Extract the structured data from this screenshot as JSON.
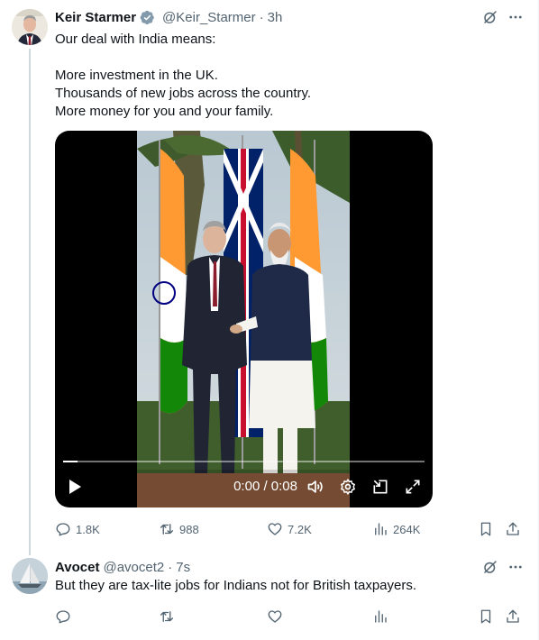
{
  "main_tweet": {
    "author_name": "Keir Starmer",
    "handle": "@Keir_Starmer",
    "separator": "·",
    "time": "3h",
    "text_lines": [
      "Our deal with India means:",
      "",
      "More investment in the UK.",
      "Thousands of new jobs across the country.",
      "More money for you and your family."
    ],
    "video": {
      "time_display": "0:00 / 0:08",
      "progress_fraction": 0.04
    },
    "stats": {
      "replies": "1.8K",
      "reposts": "988",
      "likes": "7.2K",
      "views": "264K"
    }
  },
  "reply_tweet": {
    "author_name": "Avocet",
    "handle": "@avocet2",
    "separator": "·",
    "time": "7s",
    "text": "But they are tax-lite jobs for Indians not for British taxpayers."
  },
  "icons": {
    "verified": "verified-badge-icon",
    "grok": "grok-icon",
    "more": "more-icon",
    "reply": "reply-icon",
    "repost": "repost-icon",
    "like": "like-icon",
    "views": "views-icon",
    "bookmark": "bookmark-icon",
    "share": "share-icon",
    "play": "play-icon",
    "volume": "volume-icon",
    "settings": "settings-icon",
    "pip": "picture-in-picture-icon",
    "fullscreen": "fullscreen-icon"
  },
  "colors": {
    "text_primary": "#0f1419",
    "text_secondary": "#536471",
    "verified_blue": "#829aab",
    "thread_line": "#cfd9de"
  }
}
